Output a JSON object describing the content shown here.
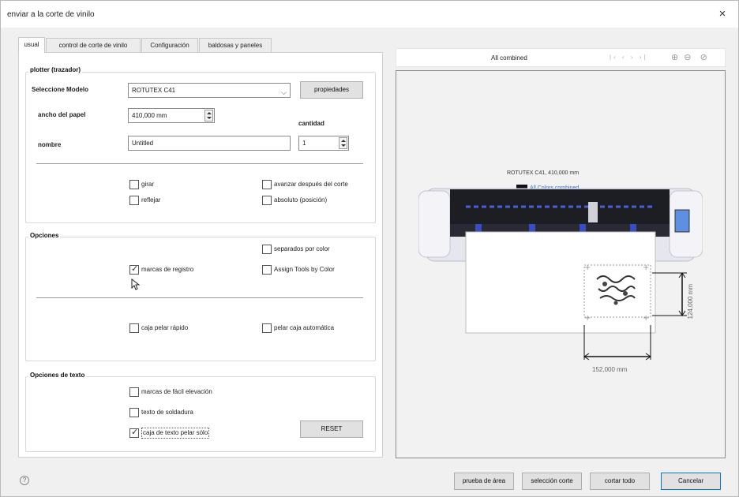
{
  "window": {
    "title": "enviar a la corte de vinilo",
    "close_glyph": "×"
  },
  "tabs": [
    {
      "label": "usual",
      "active": true
    },
    {
      "label": "control de corte de vinilo",
      "active": false
    },
    {
      "label": "Configuración",
      "active": false
    },
    {
      "label": "baldosas y paneles",
      "active": false
    }
  ],
  "plotter": {
    "legend": "plotter (trazador)",
    "model_label": "Seleccione Modelo",
    "model_value": "ROTUTEX C41",
    "properties_button": "propiedades",
    "paper_width_label": "ancho del papel",
    "paper_width_value": "410,000 mm",
    "quantity_label": "cantidad",
    "quantity_value": "1",
    "name_label": "nombre",
    "name_value": "Untitled",
    "rotate": {
      "label": "girar",
      "checked": false
    },
    "mirror": {
      "label": "reflejar",
      "checked": false
    },
    "advance": {
      "label": "avanzar después del corte",
      "checked": false
    },
    "absolute": {
      "label": "absoluto (posición)",
      "checked": false
    }
  },
  "options": {
    "legend": "Opciones",
    "separated": {
      "label": "separados por color",
      "checked": false
    },
    "registration": {
      "label": "marcas de registro",
      "checked": true
    },
    "assign_tools": {
      "label": "Assign Tools by Color",
      "checked": false
    },
    "quick_weed": {
      "label": "caja pelar rápido",
      "checked": false
    },
    "auto_weed": {
      "label": "pelar caja automática",
      "checked": false
    }
  },
  "text_options": {
    "legend": "Opciones de texto",
    "easy_lift": {
      "label": "marcas de fácil elevación",
      "checked": false
    },
    "weld": {
      "label": "texto de soldadura",
      "checked": false
    },
    "weed_box": {
      "label": "caja de texto pelar sólo",
      "checked": true
    },
    "reset_button": "RESET"
  },
  "preview": {
    "combined_label": "All combined",
    "nav_icons": [
      "first-icon",
      "prev-icon",
      "next-icon",
      "last-icon"
    ],
    "zoom_icons": [
      "zoom-in-icon",
      "zoom-out-icon",
      "refresh-icon"
    ],
    "model_info": "ROTUTEX C41,  410,000 mm",
    "colors_info": "All Colors combined",
    "height_dim": "124,000 mm",
    "width_dim": "152,000 mm"
  },
  "footer": {
    "help_glyph": "?",
    "area_test": "prueba de área",
    "cut_selection": "selección corte",
    "cut_all": "cortar todo",
    "cancel": "Cancelar"
  }
}
